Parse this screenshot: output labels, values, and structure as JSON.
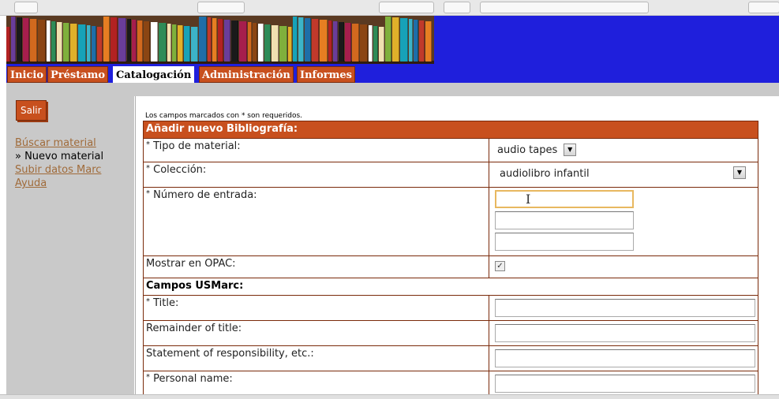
{
  "nav_tabs": [
    {
      "label": "Inicio"
    },
    {
      "label": "Préstamo"
    },
    {
      "label": "Catalogación"
    },
    {
      "label": "Administración"
    },
    {
      "label": "Informes"
    }
  ],
  "sidebar": {
    "logout_label": "Salir",
    "links": [
      {
        "label": "Búscar material"
      },
      {
        "label": "» Nuevo material"
      },
      {
        "label": "Subir datos Marc"
      },
      {
        "label": "Ayuda"
      }
    ]
  },
  "form": {
    "required_note": "Los campos marcados con * son requeridos.",
    "title": "Añadir nuevo Bibliografía:",
    "required_mark": "*",
    "material_type_label": "Tipo de material:",
    "material_type_value": "audio tapes",
    "collection_label": "Colección:",
    "collection_value": "audiolibro infantil",
    "entry_number_label": "Número de entrada:",
    "opac_label": "Mostrar en OPAC:",
    "opac_checked": true,
    "usmarc_heading": "Campos USMarc:",
    "fields": [
      {
        "label": "Title:"
      },
      {
        "label": "Remainder of title:"
      },
      {
        "label": "Statement of responsibility, etc.:"
      },
      {
        "label": "Personal name:"
      }
    ]
  },
  "colors": {
    "accent": "#c8501e",
    "banner_blue": "#1f1fdc",
    "sidebar_gray": "#c9c9c9",
    "link": "#a06b3a"
  }
}
